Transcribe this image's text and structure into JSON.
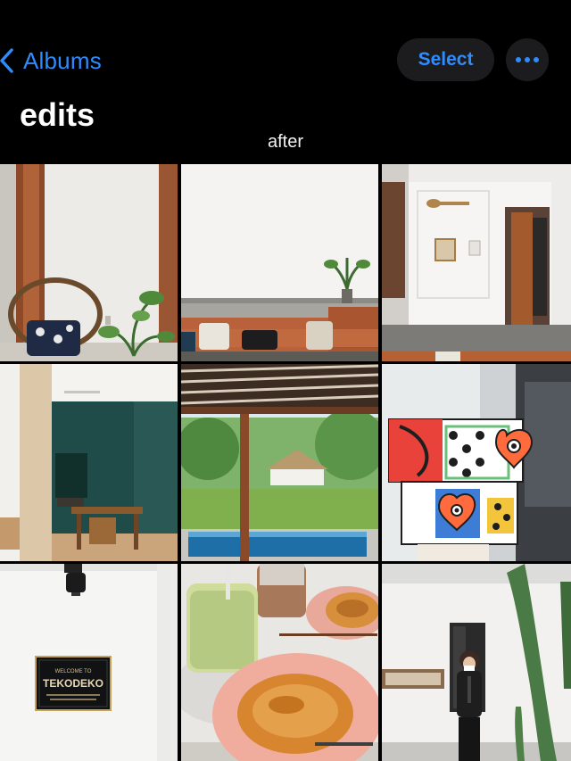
{
  "nav": {
    "back_label": "Albums",
    "select_label": "Select"
  },
  "album": {
    "title": "edits",
    "subtitle": "after"
  },
  "photos": [
    {
      "subject": "chair-and-plant"
    },
    {
      "subject": "sofa-lounge"
    },
    {
      "subject": "white-hallway"
    },
    {
      "subject": "cafe-interior"
    },
    {
      "subject": "pool-pergola"
    },
    {
      "subject": "colorful-boxes"
    },
    {
      "subject": "tekodeko-sign"
    },
    {
      "subject": "drinks-and-croissant"
    },
    {
      "subject": "person-and-cactus"
    }
  ],
  "sign": {
    "welcome": "WELCOME TO",
    "name": "TEKODEKO"
  },
  "colors": {
    "accent": "#2f8cff",
    "background": "#000000",
    "button_bg": "#1c1c1e"
  },
  "icons": {
    "back": "chevron-left-icon",
    "more": "ellipsis-icon"
  }
}
